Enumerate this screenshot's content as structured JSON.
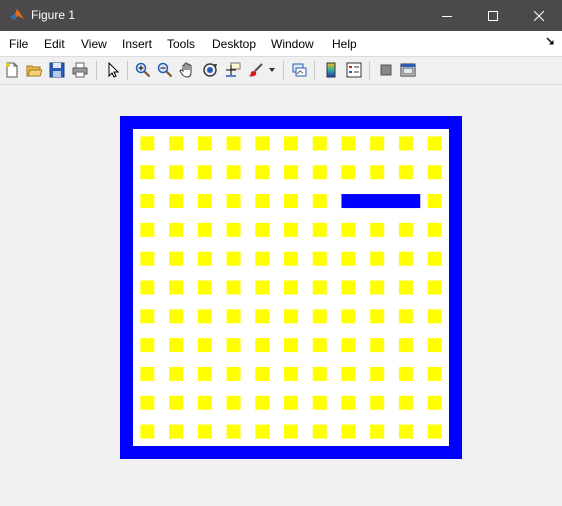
{
  "window": {
    "title": "Figure 1",
    "controls": [
      "minimize-icon",
      "maximize-icon",
      "close-icon"
    ]
  },
  "menu": [
    "File",
    "Edit",
    "View",
    "Insert",
    "Tools",
    "Desktop",
    "Window",
    "Help"
  ],
  "toolbar": [
    "new-figure-icon",
    "open-file-icon",
    "save-icon",
    "print-icon",
    "pointer-icon",
    "zoom-in-icon",
    "zoom-out-icon",
    "pan-icon",
    "rotate-3d-icon",
    "data-cursor-icon",
    "brush-icon",
    "link-plot-icon",
    "colorbar-icon",
    "legend-icon",
    "hide-plot-tools-icon",
    "show-plot-tools-icon"
  ],
  "game": {
    "type": "snake",
    "grid": {
      "cols": 11,
      "rows": 11
    },
    "snake_head": [
      10,
      2
    ],
    "snake_body": [
      [
        7,
        2
      ],
      [
        8,
        2
      ],
      [
        9,
        2
      ]
    ],
    "colors": {
      "wall": "#0000ff",
      "snake": "#0000ff",
      "pellet": "#ffff00",
      "board": "#ffffff",
      "background": "#f0f0f0"
    }
  }
}
